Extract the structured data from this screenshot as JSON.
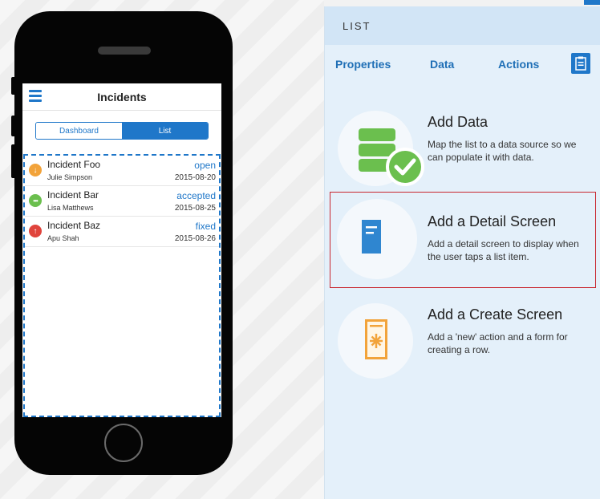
{
  "phone": {
    "app_title": "Incidents",
    "segments": {
      "dashboard": "Dashboard",
      "list": "List"
    },
    "rows": [
      {
        "title": "Incident Foo",
        "person": "Julie Simpson",
        "status": "open",
        "date": "2015-08-20",
        "icon": "arrow-down-icon",
        "color": "#f2a33a",
        "glyph": "↓"
      },
      {
        "title": "Incident Bar",
        "person": "Lisa Matthews",
        "status": "accepted",
        "date": "2015-08-25",
        "icon": "ellipsis-icon",
        "color": "#6bbf4e",
        "glyph": "•••"
      },
      {
        "title": "Incident Baz",
        "person": "Apu Shah",
        "status": "fixed",
        "date": "2015-08-26",
        "icon": "arrow-up-icon",
        "color": "#e0443c",
        "glyph": "↑"
      }
    ]
  },
  "panel": {
    "header": "LIST",
    "tabs": {
      "properties": "Properties",
      "data": "Data",
      "actions": "Actions"
    },
    "cards": [
      {
        "title": "Add Data",
        "desc": "Map the list to a data source so we can populate it with data."
      },
      {
        "title": "Add a Detail Screen",
        "desc": "Add a detail screen to display when the user taps a list item."
      },
      {
        "title": "Add a Create Screen",
        "desc": "Add a 'new' action and a form for creating a row."
      }
    ]
  },
  "colors": {
    "accent": "#1f77c9",
    "selection": "#c8262e",
    "green": "#6bbf4e",
    "orange": "#f2a33a"
  }
}
